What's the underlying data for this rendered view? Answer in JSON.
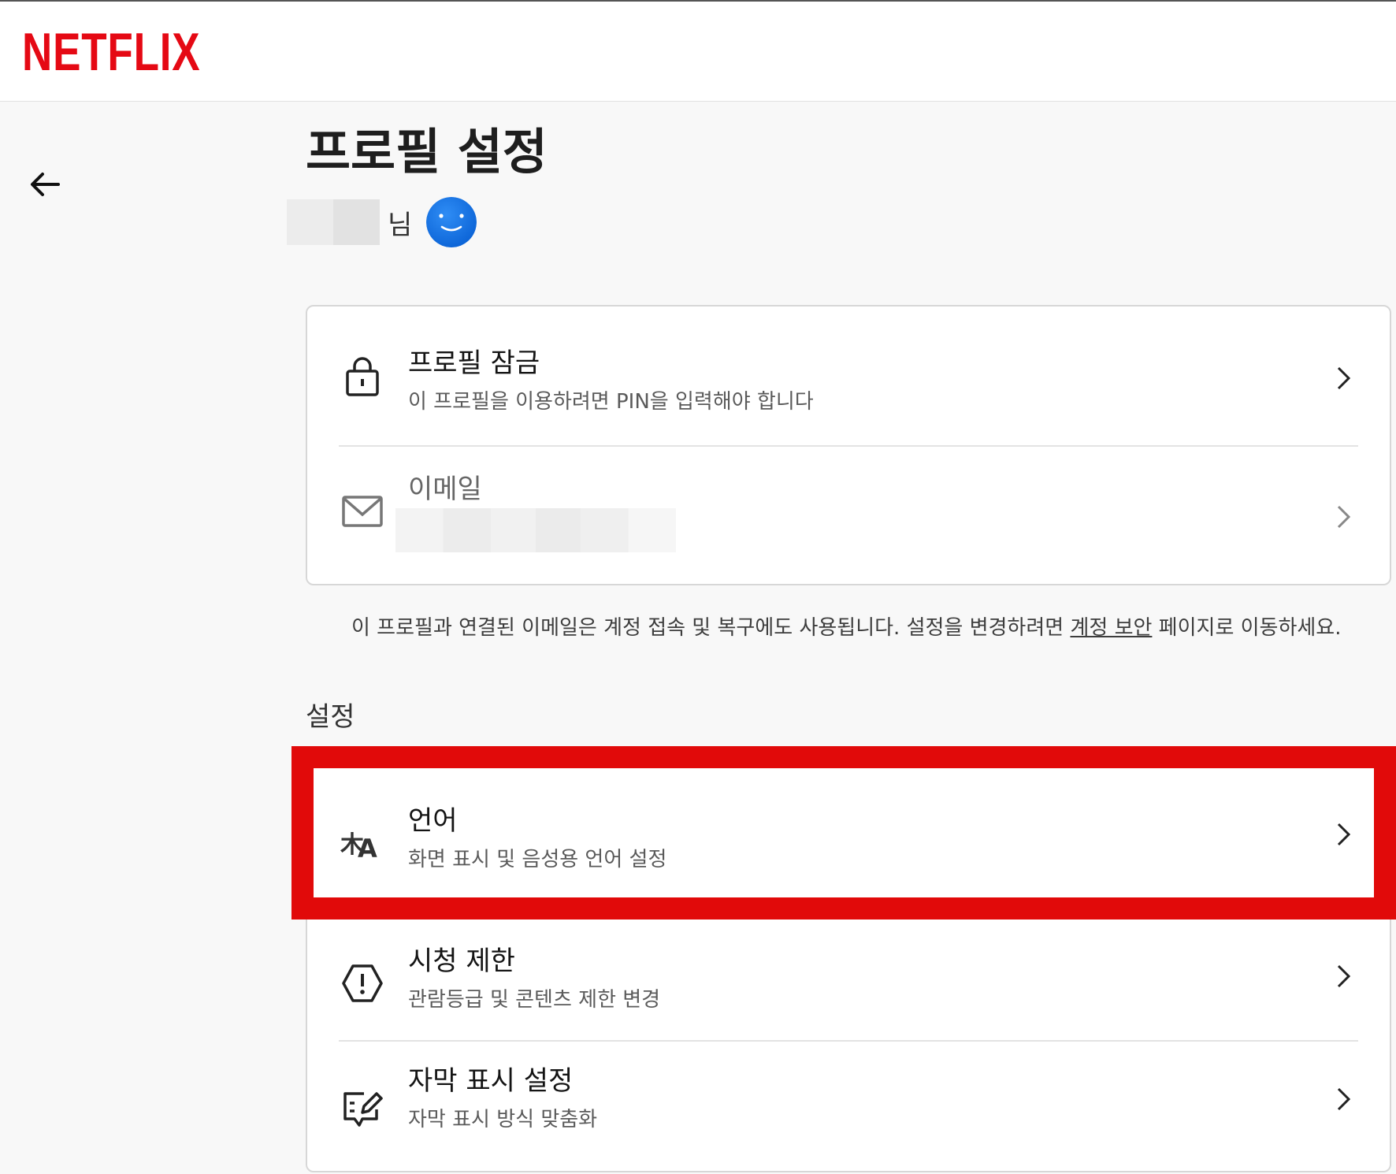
{
  "brand": {
    "logo_text": "NETFLIX",
    "color": "#e50914"
  },
  "page": {
    "title": "프로필 설정",
    "user_suffix": "님"
  },
  "profile_card": {
    "lock": {
      "title": "프로필 잠금",
      "subtitle": "이 프로필을 이용하려면 PIN을 입력해야 합니다",
      "icon": "lock-icon"
    },
    "email": {
      "title": "이메일",
      "icon": "mail-icon"
    }
  },
  "note": {
    "text_before": "이 프로필과 연결된 이메일은 계정 접속 및 복구에도 사용됩니다. 설정을 변경하려면 ",
    "link": "계정 보안",
    "text_after": " 페이지로 이동하세요."
  },
  "settings": {
    "label": "설정",
    "items": [
      {
        "title": "언어",
        "subtitle": "화면 표시 및 음성용 언어 설정",
        "icon": "translate-icon",
        "highlighted": true
      },
      {
        "title": "시청 제한",
        "subtitle": "관람등급 및 콘텐츠 제한 변경",
        "icon": "warning-hexagon-icon"
      },
      {
        "title": "자막 표시 설정",
        "subtitle": "자막 표시 방식 맞춤화",
        "icon": "subtitle-edit-icon"
      }
    ]
  },
  "colors": {
    "highlight": "#e10a0a",
    "avatar": "#1a73e8"
  }
}
